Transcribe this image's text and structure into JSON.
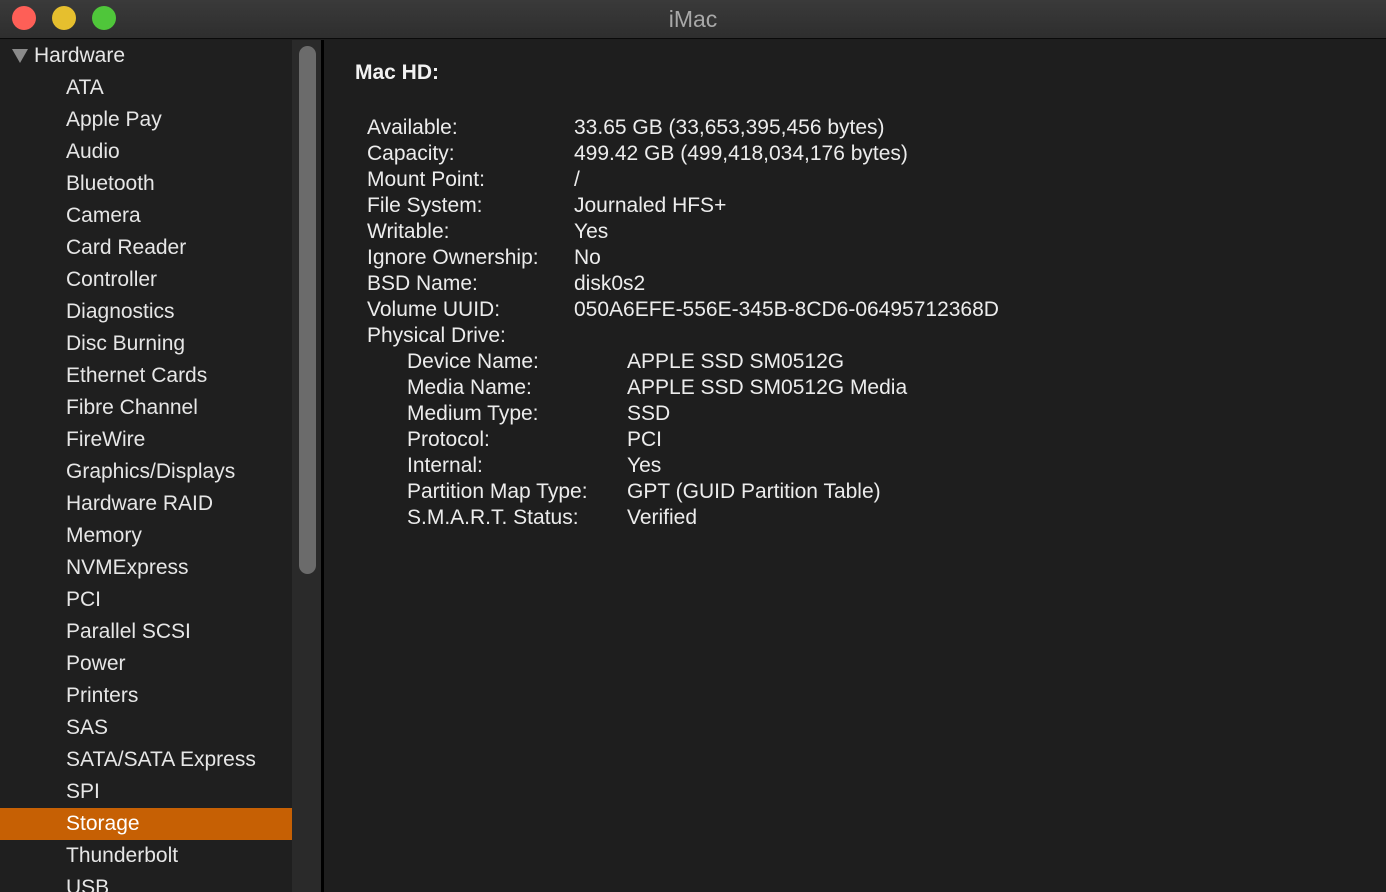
{
  "window": {
    "title": "iMac",
    "colors": {
      "close": "#fe5f57",
      "minimize": "#e6bf2e",
      "zoom": "#4fc63a",
      "accent": "#c66004"
    }
  },
  "sidebar": {
    "group": "Hardware",
    "items": [
      "ATA",
      "Apple Pay",
      "Audio",
      "Bluetooth",
      "Camera",
      "Card Reader",
      "Controller",
      "Diagnostics",
      "Disc Burning",
      "Ethernet Cards",
      "Fibre Channel",
      "FireWire",
      "Graphics/Displays",
      "Hardware RAID",
      "Memory",
      "NVMExpress",
      "PCI",
      "Parallel SCSI",
      "Power",
      "Printers",
      "SAS",
      "SATA/SATA Express",
      "SPI",
      "Storage",
      "Thunderbolt",
      "USB"
    ],
    "selected": "Storage"
  },
  "detail": {
    "heading": "Mac HD:",
    "rows": [
      {
        "label": "Available:",
        "value": "33.65 GB (33,653,395,456 bytes)"
      },
      {
        "label": "Capacity:",
        "value": "499.42 GB (499,418,034,176 bytes)"
      },
      {
        "label": "Mount Point:",
        "value": "/"
      },
      {
        "label": "File System:",
        "value": "Journaled HFS+"
      },
      {
        "label": "Writable:",
        "value": "Yes"
      },
      {
        "label": "Ignore Ownership:",
        "value": "No"
      },
      {
        "label": "BSD Name:",
        "value": "disk0s2"
      },
      {
        "label": "Volume UUID:",
        "value": "050A6EFE-556E-345B-8CD6-06495712368D"
      },
      {
        "label": "Physical Drive:",
        "value": ""
      }
    ],
    "drive_rows": [
      {
        "label": "Device Name:",
        "value": "APPLE SSD SM0512G"
      },
      {
        "label": "Media Name:",
        "value": "APPLE SSD SM0512G Media"
      },
      {
        "label": "Medium Type:",
        "value": "SSD"
      },
      {
        "label": "Protocol:",
        "value": "PCI"
      },
      {
        "label": "Internal:",
        "value": "Yes"
      },
      {
        "label": "Partition Map Type:",
        "value": "GPT (GUID Partition Table)"
      },
      {
        "label": "S.M.A.R.T. Status:",
        "value": "Verified"
      }
    ]
  }
}
